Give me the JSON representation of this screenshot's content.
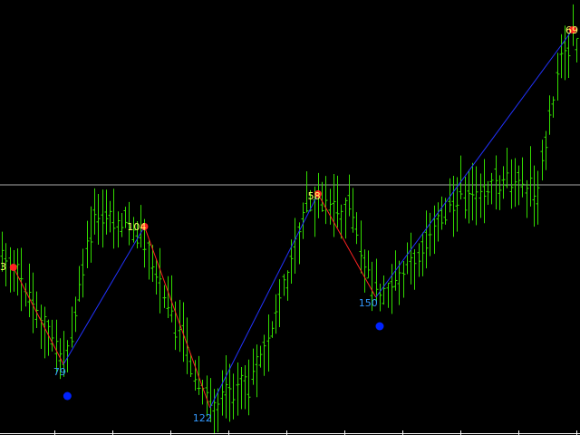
{
  "chart_data": {
    "type": "bar",
    "subtype": "ohlc",
    "bar_count": 150,
    "ylim": [
      0,
      480
    ],
    "colors": {
      "background": "#000000",
      "bars": "#33dd00",
      "zigzag_up": "#2233ff",
      "zigzag_down": "#ff2222",
      "peak_marker": "#ff2222",
      "trough_marker": "#0022ff",
      "peak_label": "#ffff66",
      "trough_label": "#3399ff",
      "hline": "#aaaaaa",
      "axis": "#ffffff"
    },
    "price_profile": [
      [
        0,
        270
      ],
      [
        3,
        295
      ],
      [
        16,
        402
      ],
      [
        24,
        240
      ],
      [
        35,
        250
      ],
      [
        54,
        450
      ],
      [
        64,
        420
      ],
      [
        70,
        360
      ],
      [
        80,
        218
      ],
      [
        90,
        232
      ],
      [
        97,
        330
      ],
      [
        102,
        312
      ],
      [
        117,
        220
      ],
      [
        124,
        210
      ],
      [
        130,
        196
      ],
      [
        139,
        210
      ],
      [
        145,
        62
      ],
      [
        150,
        40
      ]
    ],
    "zigzag": [
      {
        "bar": 3,
        "y": 295,
        "kind": "peak"
      },
      {
        "bar": 16,
        "y": 402,
        "kind": "trough"
      },
      {
        "bar": 37,
        "y": 250,
        "kind": "peak"
      },
      {
        "bar": 54,
        "y": 450,
        "kind": "trough"
      },
      {
        "bar": 82,
        "y": 214,
        "kind": "peak"
      },
      {
        "bar": 97,
        "y": 328,
        "kind": "trough"
      },
      {
        "bar": 148,
        "y": 33,
        "kind": "peak"
      }
    ],
    "swing_labels": [
      {
        "text": "3",
        "bar": 0,
        "y": 294,
        "kind": "peak"
      },
      {
        "text": "79",
        "bar": 15,
        "y": 410,
        "kind": "trough"
      },
      {
        "text": "104",
        "bar": 35,
        "y": 250,
        "kind": "peak"
      },
      {
        "text": "122",
        "bar": 52,
        "y": 461,
        "kind": "trough"
      },
      {
        "text": "58",
        "bar": 81,
        "y": 216,
        "kind": "peak"
      },
      {
        "text": "150",
        "bar": 95,
        "y": 334,
        "kind": "trough"
      },
      {
        "text": "69",
        "bar": 148,
        "y": 33,
        "kind": "peak"
      }
    ],
    "extreme_dots": [
      {
        "bar": 17,
        "y": 437,
        "kind": "trough"
      },
      {
        "bar": 98,
        "y": 360,
        "kind": "trough"
      }
    ],
    "hline_y": 204
  }
}
